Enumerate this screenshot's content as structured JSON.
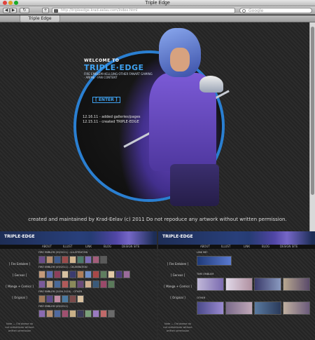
{
  "window": {
    "title": "Triple Edge"
  },
  "toolbar": {
    "back": "◀",
    "forward": "▶",
    "refresh": "↻",
    "add": "+",
    "url": "http://tripleedge.krad-eelav.com/index.html",
    "search_placeholder": "Google"
  },
  "tabs": [
    {
      "label": "Triple Edge"
    }
  ],
  "hero": {
    "welcome": "WELCOME TO",
    "brand": "TRIPLE·EDGE",
    "subtitle": "FIRE EMBLEM·HELLSING·OTHER FANART GAMING · ANIME · FAN CONTENT",
    "enter": "[ ENTER ]",
    "updates": [
      "12.16.11 - added galleries/pages",
      "12.15.11 - created TRIPLE-EDGE"
    ]
  },
  "footer": {
    "copyright": "created and maintained by Krad-Eelav (c) 2011 Do not repoduce any artwork without written permission."
  },
  "panels": {
    "left": {
      "logo": "TRIPLE·EDGE",
      "nav": [
        "ABOUT",
        "ILLUST",
        "LINK",
        "BLOG",
        "DESIGN SITE"
      ],
      "menu": [
        "[ Fire Emblem ]",
        "[ Gensos ]",
        "[ Manga + Comics ]",
        "[ Original ]"
      ],
      "note": "Note — Old please do not redistribute without written permission",
      "sections": [
        "FIRE EMBLEM (09/2011) - ILLUSTRATION",
        "FIRE EMBLEM (09/2011) - CELEBRATION",
        "FIRE EMBLEM (2009-2010) - OTHER",
        "FIRE EMBLEM (09/2011)"
      ]
    },
    "right": {
      "logo": "TRIPLE·EDGE",
      "nav": [
        "ABOUT",
        "ILLUST",
        "LINK",
        "BLOG",
        "DESIGN SITE"
      ],
      "menu": [
        "[ Fire Emblem ]",
        "[ Gensos ]",
        "[ Manga + Comics ]",
        "[ Original ]"
      ],
      "note": "Note — Old please do not redistribute without written permission",
      "sections": [
        "LINK ME!",
        "TIME EMBLEM",
        "OTHER"
      ]
    }
  },
  "colors": {
    "accent": "#3ea1f0",
    "ring": "#2a7fd1",
    "purple": "#6f4bd0"
  }
}
